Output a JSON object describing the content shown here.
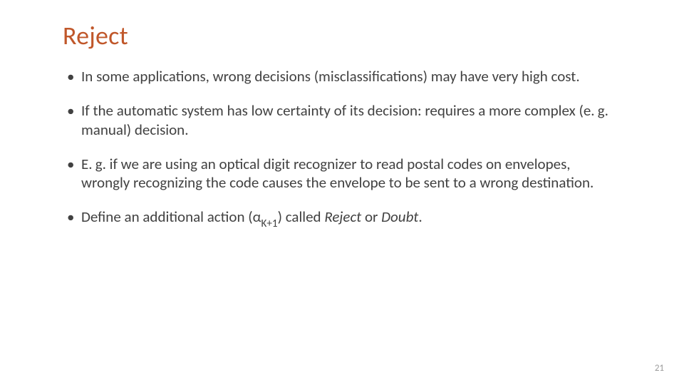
{
  "title": "Reject",
  "bullets": {
    "b1": "In some applications, wrong decisions (misclassifications) may have very high cost.",
    "b2": "If the automatic system has low certainty of its decision: requires a more complex (e. g. manual) decision.",
    "b3": "E. g. if we are using an optical digit recognizer to read postal codes on envelopes, wrongly recognizing the code causes the envelope to be sent to a wrong destination.",
    "b4_pre": "Define an additional action (α",
    "b4_sub": "K+1",
    "b4_mid": ") called ",
    "b4_it1": "Reject",
    "b4_or": " or ",
    "b4_it2": "Doubt",
    "b4_post": "."
  },
  "page_number": "21"
}
